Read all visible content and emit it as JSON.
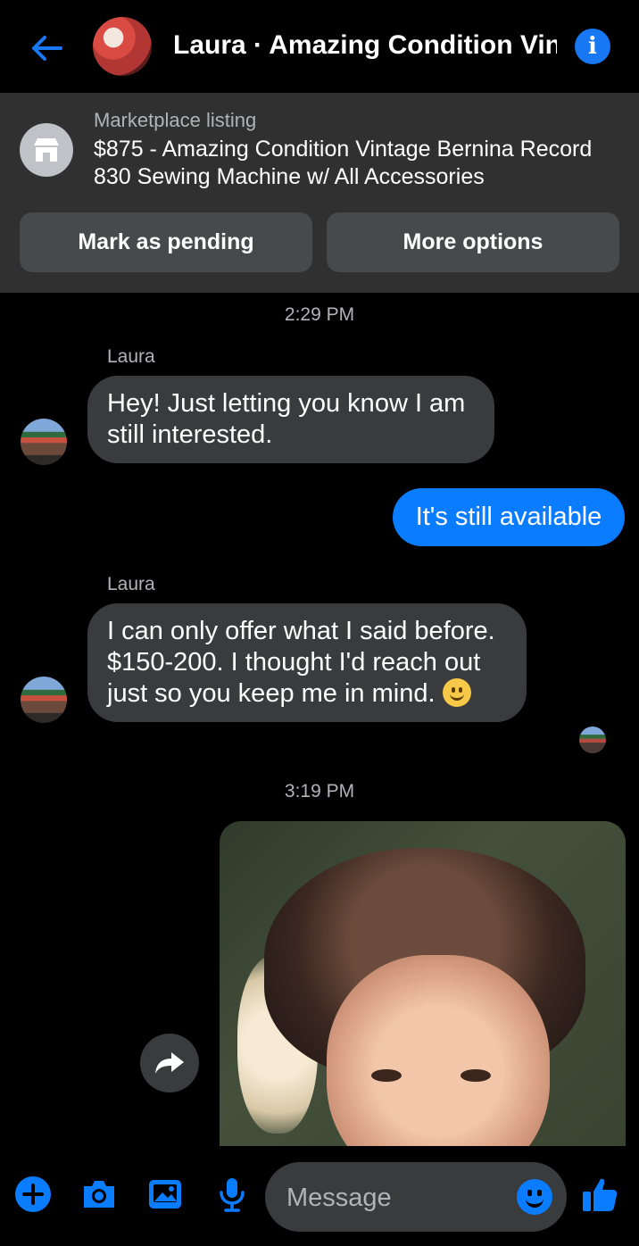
{
  "header": {
    "title": "Laura · Amazing Condition Vin...",
    "back_icon": "arrow-left-icon",
    "info_icon": "info-icon"
  },
  "listing": {
    "label": "Marketplace listing",
    "title": "$875 - Amazing Condition Vintage Bernina Record 830 Sewing Machine w/ All Accessories",
    "buttons": {
      "pending": "Mark as pending",
      "more": "More options"
    }
  },
  "chat": {
    "time1": "2:29 PM",
    "sender1": "Laura",
    "msg1": "Hey! Just letting you know I am still interested.",
    "out1": "It's still available",
    "sender2": "Laura",
    "msg2": "I can only offer what I said before. $150-200. I thought I'd reach out just so you keep me in mind.",
    "time2": "3:19 PM"
  },
  "composer": {
    "placeholder": "Message"
  },
  "colors": {
    "accent": "#0a7cff",
    "panel": "#303031",
    "bubble_in": "#3a3b3c"
  }
}
